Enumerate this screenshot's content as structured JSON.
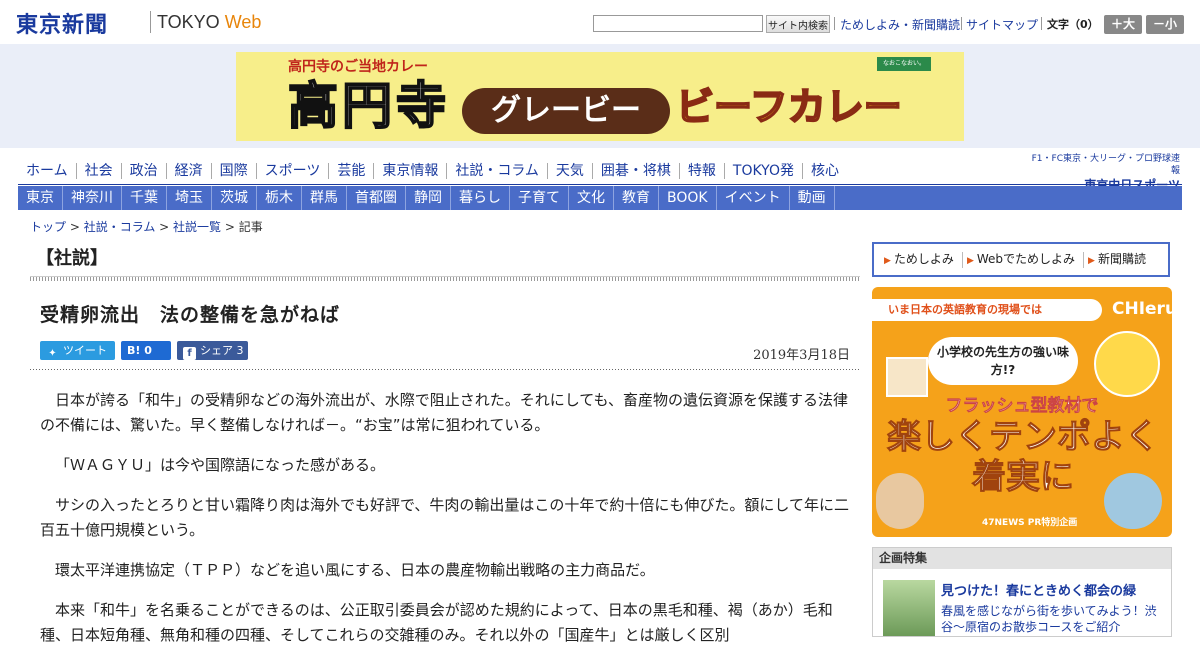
{
  "header": {
    "logo_jp": "東京新聞",
    "logo_en": "TOKYO",
    "logo_web": "Web",
    "search_placeholder": "",
    "search_button": "サイト内検索",
    "links": [
      "ためしよみ・新聞購読",
      "サイトマップ"
    ],
    "font_size_label": "文字（0）",
    "font_larger": "＋大",
    "font_smaller": "－小"
  },
  "ad": {
    "sub": "高円寺のご当地カレー",
    "main1": "高円寺",
    "main2": "グレービー",
    "main3": "ビーフカレー",
    "badge": "なおこなおい。"
  },
  "nav": {
    "primary": [
      "ホーム",
      "社会",
      "政治",
      "経済",
      "国際",
      "スポーツ",
      "芸能",
      "東京情報",
      "社説・コラム",
      "天気",
      "囲碁・将棋",
      "特報",
      "TOKYO発",
      "核心"
    ],
    "chunichi_top": "F1・FC東京・大リーグ・プロ野球速報",
    "chunichi_logo": "東京中日スポーツ",
    "secondary": [
      "東京",
      "神奈川",
      "千葉",
      "埼玉",
      "茨城",
      "栃木",
      "群馬",
      "首都圏",
      "静岡",
      "暮らし",
      "子育て",
      "文化",
      "教育",
      "BOOK",
      "イベント",
      "動画"
    ]
  },
  "breadcrumb": {
    "items": [
      "トップ",
      "社説・コラム",
      "社説一覧"
    ],
    "separator": " > ",
    "current": "記事"
  },
  "article": {
    "section": "【社説】",
    "title": "受精卵流出　法の整備を急がねば",
    "tweet": "ツイート",
    "hatena_icon": "B!",
    "hatena_count": "0",
    "share": "シェア",
    "share_count": "3",
    "date": "2019年3月18日",
    "paragraphs": [
      "日本が誇る「和牛」の受精卵などの海外流出が、水際で阻止された。それにしても、畜産物の遺伝資源を保護する法律の不備には、驚いた。早く整備しなければ－。“お宝”は常に狙われている。",
      "「ＷＡＧＹＵ」は今や国際語になった感がある。",
      "サシの入ったとろりと甘い霜降り肉は海外でも好評で、牛肉の輸出量はこの十年で約十倍にも伸びた。額にして年に二百五十億円規模という。",
      "環太平洋連携協定（ＴＰＰ）などを追い風にする、日本の農産物輸出戦略の主力商品だ。",
      "本来「和牛」を名乗ることができるのは、公正取引委員会が認めた規約によって、日本の黒毛和種、褐（あか）毛和種、日本短角種、無角和種の四種、そしてこれらの交雑種のみ。それ以外の「国産牛」とは厳しく区別"
    ]
  },
  "sidebar": {
    "buttons": [
      "ためしよみ",
      "Webでためしよみ",
      "新聞購読"
    ],
    "ad_banner": "いま日本の英語教育の現場では",
    "ad_brand": "CHIeru",
    "ad_bubble": "小学校の先生方の強い味方!?",
    "ad_flash": "フラッシュ型教材で",
    "ad_big": "楽しくテンポよく着実に",
    "ad_foot": "47NEWS PR特別企画",
    "feature_head": "企画特集",
    "feature_title": "見つけた！春にときめく都会の緑",
    "feature_desc": "春風を感じながら街を歩いてみよう！渋谷～原宿のお散歩コースをご紹介"
  }
}
